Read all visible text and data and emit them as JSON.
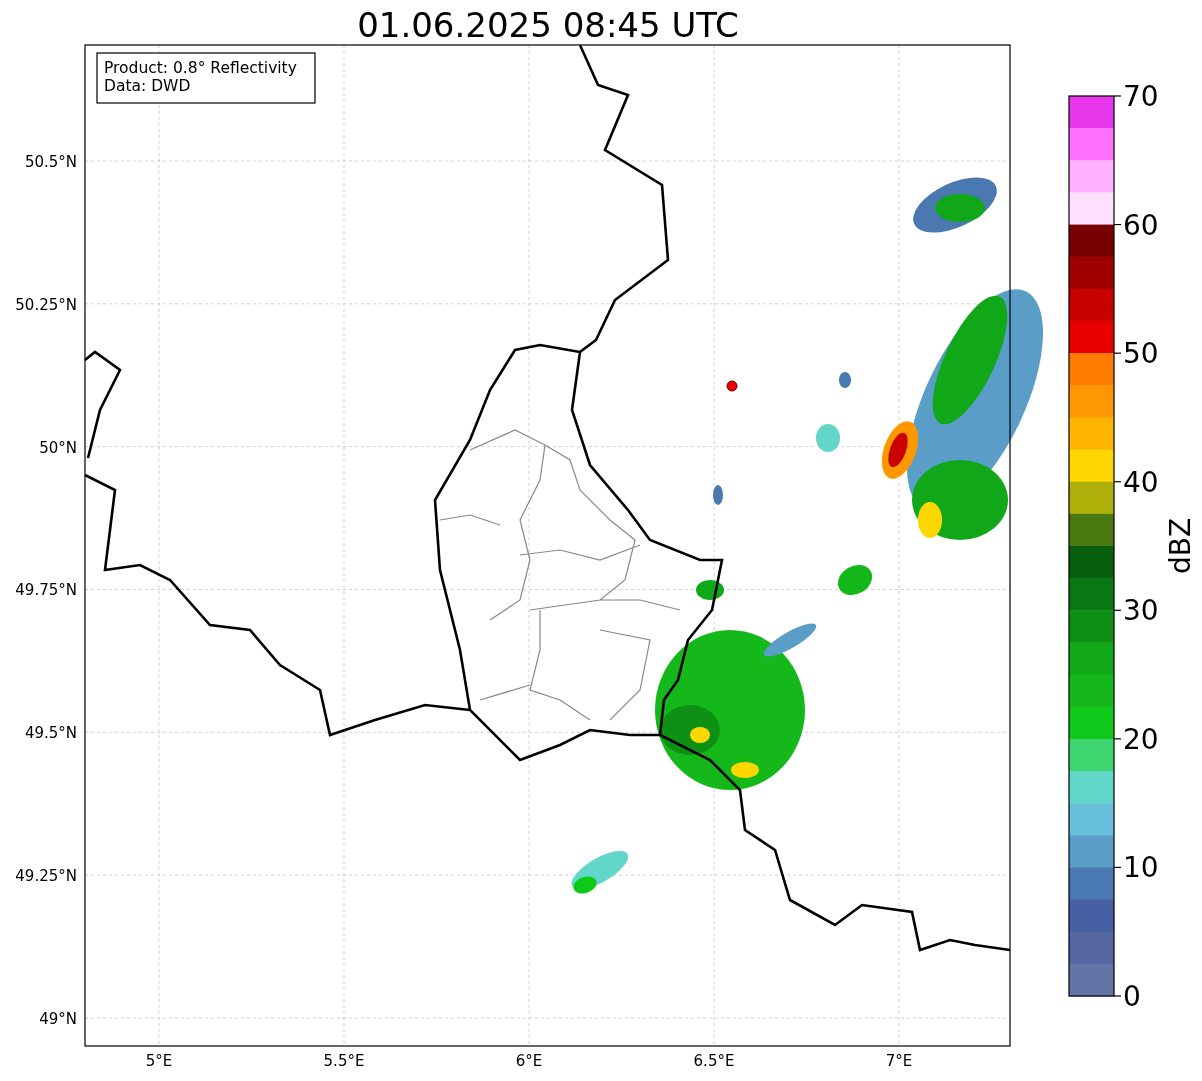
{
  "title": "01.06.2025 08:45 UTC",
  "legend": [
    "Product: 0.8° Reflectivity",
    "Data: DWD"
  ],
  "lat_ticks": [
    "50.5°N",
    "50.25°N",
    "50°N",
    "49.75°N",
    "49.5°N",
    "49.25°N",
    "49°N"
  ],
  "lon_ticks": [
    "5°E",
    "5.5°E",
    "6°E",
    "6.5°E",
    "7°E"
  ],
  "colorbar": {
    "label": "dBZ",
    "ticks": [
      "70",
      "60",
      "50",
      "40",
      "30",
      "20",
      "10",
      "0"
    ],
    "segments": [
      {
        "color": "#e838ee"
      },
      {
        "color": "#ff70ff"
      },
      {
        "color": "#ffb0ff"
      },
      {
        "color": "#ffe0ff"
      },
      {
        "color": "#780000"
      },
      {
        "color": "#a00000"
      },
      {
        "color": "#c80000"
      },
      {
        "color": "#e80000"
      },
      {
        "color": "#ff7c00"
      },
      {
        "color": "#ff9800"
      },
      {
        "color": "#ffb400"
      },
      {
        "color": "#ffd700"
      },
      {
        "color": "#aeb00a"
      },
      {
        "color": "#497810"
      },
      {
        "color": "#085e0e"
      },
      {
        "color": "#0a7812"
      },
      {
        "color": "#0e9014"
      },
      {
        "color": "#10a818"
      },
      {
        "color": "#14b81a"
      },
      {
        "color": "#10c81a"
      },
      {
        "color": "#3dd670"
      },
      {
        "color": "#62d6c8"
      },
      {
        "color": "#66c0dc"
      },
      {
        "color": "#5a9ec8"
      },
      {
        "color": "#4a78b0"
      },
      {
        "color": "#4660a3"
      },
      {
        "color": "#5567a0"
      },
      {
        "color": "#6373a6"
      }
    ]
  }
}
